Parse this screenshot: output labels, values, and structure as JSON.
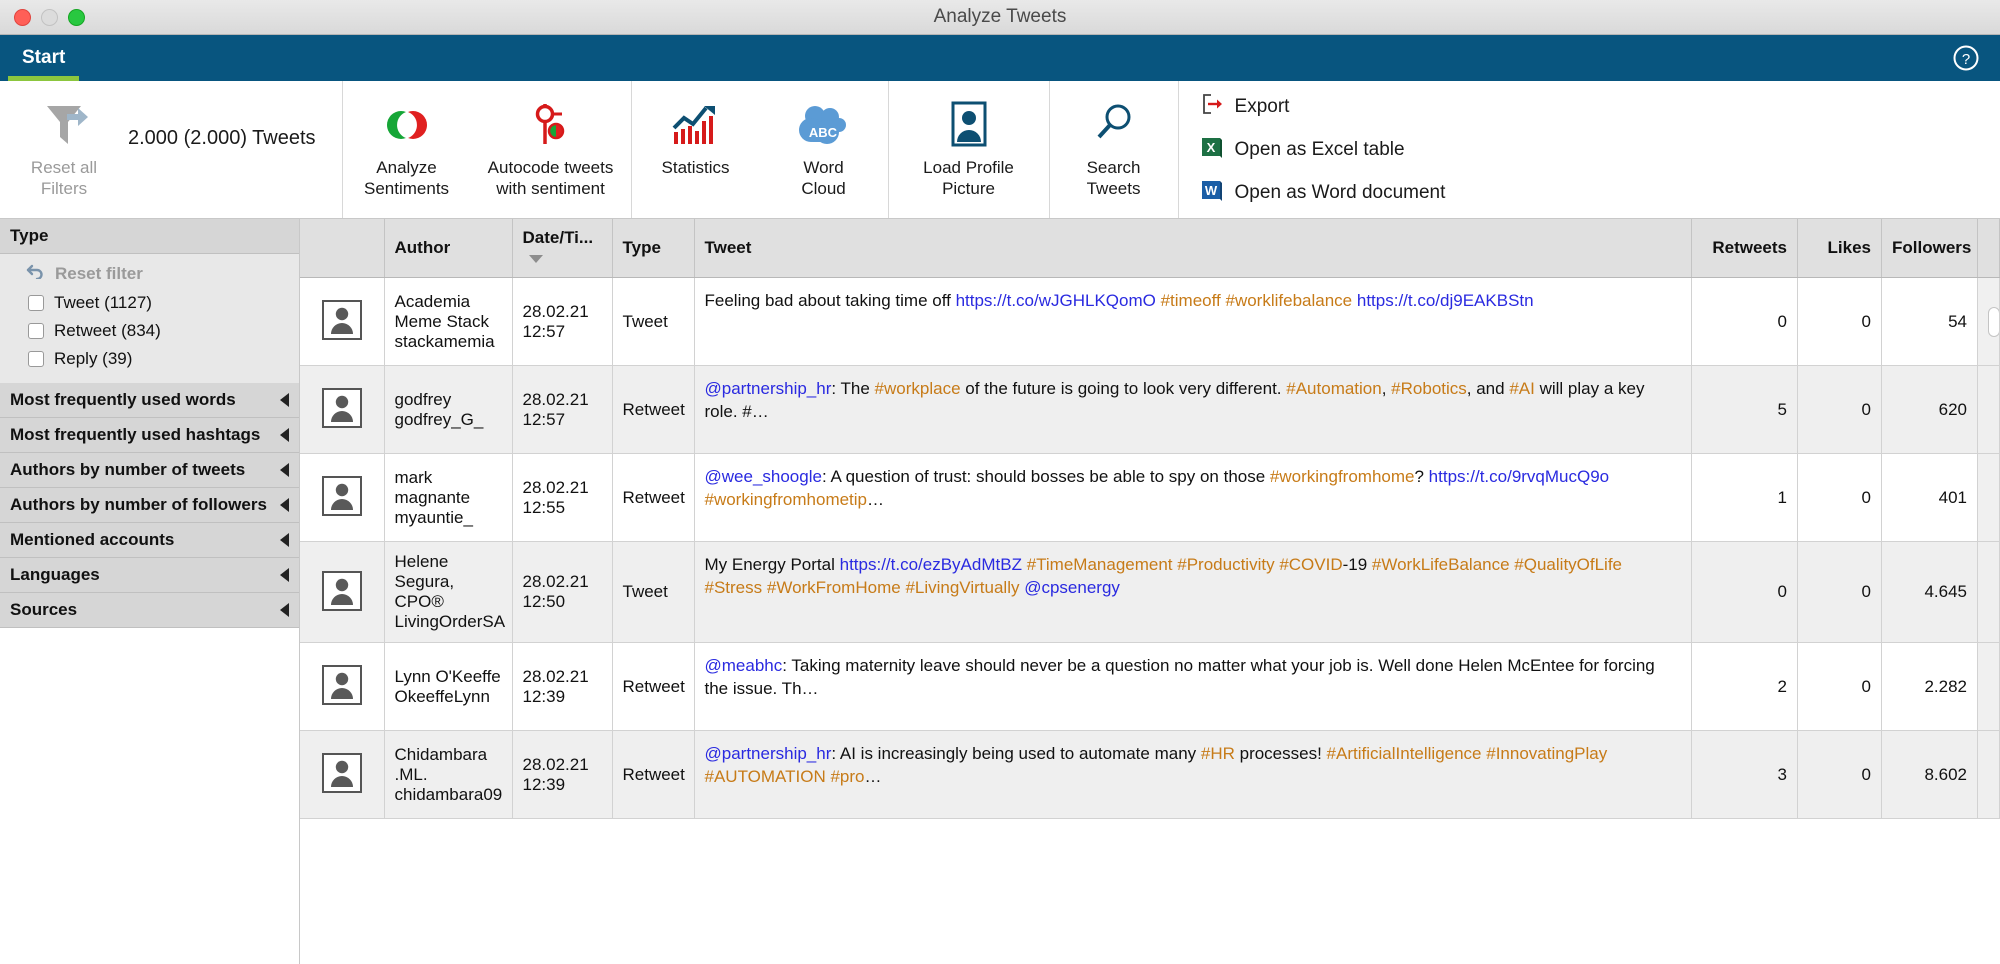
{
  "window": {
    "title": "Analyze Tweets"
  },
  "ribbon": {
    "tab_label": "Start",
    "help_icon": "help-circle-icon",
    "reset_all": {
      "icon": "reset-filter-funnel-icon",
      "label": "Reset all\nFilters"
    },
    "counter": "2.000 (2.000) Tweets",
    "items": [
      {
        "icon": "sentiment-circle-icon",
        "label": "Analyze\nSentiments"
      },
      {
        "icon": "autocode-sentiment-icon",
        "label": "Autocode tweets\nwith sentiment"
      },
      {
        "icon": "statistics-chart-icon",
        "label": "Statistics"
      },
      {
        "icon": "word-cloud-abc-icon",
        "label": "Word\nCloud"
      },
      {
        "icon": "profile-picture-icon",
        "label": "Load Profile\nPicture"
      },
      {
        "icon": "magnifier-search-icon",
        "label": "Search\nTweets"
      }
    ],
    "export": [
      {
        "icon": "export-arrow-icon",
        "label": "Export"
      },
      {
        "icon": "excel-icon",
        "label": "Open as Excel table"
      },
      {
        "icon": "word-icon",
        "label": "Open as Word document"
      }
    ]
  },
  "sidebar": {
    "sections": [
      {
        "title": "Type",
        "expanded": true,
        "reset_label": "Reset filter",
        "reset_icon": "undo-arrow-icon",
        "options": [
          {
            "label": "Tweet (1127)",
            "checked": false
          },
          {
            "label": "Retweet (834)",
            "checked": false
          },
          {
            "label": "Reply (39)",
            "checked": false
          }
        ]
      },
      {
        "title": "Most frequently used words",
        "expanded": false
      },
      {
        "title": "Most frequently used hashtags",
        "expanded": false
      },
      {
        "title": "Authors by number of tweets",
        "expanded": false
      },
      {
        "title": "Authors by number of followers",
        "expanded": false
      },
      {
        "title": "Mentioned accounts",
        "expanded": false
      },
      {
        "title": "Languages",
        "expanded": false
      },
      {
        "title": "Sources",
        "expanded": false
      }
    ]
  },
  "table": {
    "columns": [
      {
        "key": "avatar",
        "label": "",
        "align": "center"
      },
      {
        "key": "author",
        "label": "Author",
        "align": "left"
      },
      {
        "key": "date",
        "label": "Date/Ti...",
        "align": "left",
        "sorted": "desc"
      },
      {
        "key": "type",
        "label": "Type",
        "align": "left"
      },
      {
        "key": "tweet",
        "label": "Tweet",
        "align": "left"
      },
      {
        "key": "retweets",
        "label": "Retweets",
        "align": "right"
      },
      {
        "key": "likes",
        "label": "Likes",
        "align": "right"
      },
      {
        "key": "followers",
        "label": "Followers",
        "align": "right"
      }
    ],
    "rows": [
      {
        "avatar": "person-placeholder-icon",
        "author": "Academia Meme Stack\nstackamemia",
        "date": "28.02.21\n12:57",
        "type": "Tweet",
        "tweet_parts": [
          {
            "t": "Feeling bad about taking time off ",
            "c": "plain"
          },
          {
            "t": "https://t.co/wJGHLKQomO",
            "c": "link"
          },
          {
            "t": " ",
            "c": "plain"
          },
          {
            "t": "#timeoff",
            "c": "hash"
          },
          {
            "t": " ",
            "c": "plain"
          },
          {
            "t": "#worklifebalance",
            "c": "hash"
          },
          {
            "t": " ",
            "c": "plain"
          },
          {
            "t": "https://t.co/dj9EAKBStn",
            "c": "link"
          }
        ],
        "retweets": "0",
        "likes": "0",
        "followers": "54"
      },
      {
        "avatar": "person-placeholder-icon",
        "author": "godfrey\ngodfrey_G_",
        "date": "28.02.21\n12:57",
        "type": "Retweet",
        "tweet_parts": [
          {
            "t": "@partnership_hr",
            "c": "mention"
          },
          {
            "t": ": The ",
            "c": "plain"
          },
          {
            "t": "#workplace",
            "c": "hash"
          },
          {
            "t": " of the future is going to look very different. ",
            "c": "plain"
          },
          {
            "t": "#Automation",
            "c": "hash"
          },
          {
            "t": ", ",
            "c": "plain"
          },
          {
            "t": "#Robotics",
            "c": "hash"
          },
          {
            "t": ", and ",
            "c": "plain"
          },
          {
            "t": "#AI",
            "c": "hash"
          },
          {
            "t": " will play a key role. #…",
            "c": "plain"
          }
        ],
        "retweets": "5",
        "likes": "0",
        "followers": "620"
      },
      {
        "avatar": "person-placeholder-icon",
        "author": "mark magnante\nmyauntie_",
        "date": "28.02.21\n12:55",
        "type": "Retweet",
        "tweet_parts": [
          {
            "t": "@wee_shoogle",
            "c": "mention"
          },
          {
            "t": ": A question of trust: should bosses be able to spy on those ",
            "c": "plain"
          },
          {
            "t": "#workingfromhome",
            "c": "hash"
          },
          {
            "t": "? ",
            "c": "plain"
          },
          {
            "t": "https://t.co/9rvqMucQ9o",
            "c": "link"
          },
          {
            "t": " ",
            "c": "plain"
          },
          {
            "t": "#workingfromhometip",
            "c": "hash"
          },
          {
            "t": "…",
            "c": "plain"
          }
        ],
        "retweets": "1",
        "likes": "0",
        "followers": "401"
      },
      {
        "avatar": "person-placeholder-icon",
        "author": "Helene Segura, CPO®\nLivingOrderSA",
        "date": "28.02.21\n12:50",
        "type": "Tweet",
        "tweet_parts": [
          {
            "t": "My Energy Portal ",
            "c": "plain"
          },
          {
            "t": "https://t.co/ezByAdMtBZ",
            "c": "link"
          },
          {
            "t": " ",
            "c": "plain"
          },
          {
            "t": "#TimeManagement",
            "c": "hash"
          },
          {
            "t": " ",
            "c": "plain"
          },
          {
            "t": "#Productivity",
            "c": "hash"
          },
          {
            "t": " ",
            "c": "plain"
          },
          {
            "t": "#COVID",
            "c": "hash"
          },
          {
            "t": "-19 ",
            "c": "plain"
          },
          {
            "t": "#WorkLifeBalance",
            "c": "hash"
          },
          {
            "t": " ",
            "c": "plain"
          },
          {
            "t": "#QualityOfLife",
            "c": "hash"
          },
          {
            "t": " ",
            "c": "plain"
          },
          {
            "t": "#Stress",
            "c": "hash"
          },
          {
            "t": " ",
            "c": "plain"
          },
          {
            "t": "#WorkFromHome",
            "c": "hash"
          },
          {
            "t": " ",
            "c": "plain"
          },
          {
            "t": "#LivingVirtually",
            "c": "hash"
          },
          {
            "t": " ",
            "c": "plain"
          },
          {
            "t": "@cpsenergy",
            "c": "mention"
          }
        ],
        "retweets": "0",
        "likes": "0",
        "followers": "4.645"
      },
      {
        "avatar": "person-placeholder-icon",
        "author": "Lynn O'Keeffe\nOkeeffeLynn",
        "date": "28.02.21\n12:39",
        "type": "Retweet",
        "tweet_parts": [
          {
            "t": "@meabhc",
            "c": "mention"
          },
          {
            "t": ": Taking maternity leave should never be a question no matter what your job is. Well done Helen McEntee for forcing the issue. Th…",
            "c": "plain"
          }
        ],
        "retweets": "2",
        "likes": "0",
        "followers": "2.282"
      },
      {
        "avatar": "person-placeholder-icon",
        "author": "Chidambara .ML.\nchidambara09",
        "date": "28.02.21\n12:39",
        "type": "Retweet",
        "tweet_parts": [
          {
            "t": "@partnership_hr",
            "c": "mention"
          },
          {
            "t": ": AI is increasingly being used to automate many ",
            "c": "plain"
          },
          {
            "t": "#HR",
            "c": "hash"
          },
          {
            "t": " processes! ",
            "c": "plain"
          },
          {
            "t": "#ArtificialIntelligence",
            "c": "hash"
          },
          {
            "t": " ",
            "c": "plain"
          },
          {
            "t": "#InnovatingPlay",
            "c": "hash"
          },
          {
            "t": " ",
            "c": "plain"
          },
          {
            "t": "#AUTOMATION",
            "c": "hash"
          },
          {
            "t": " ",
            "c": "plain"
          },
          {
            "t": "#pro",
            "c": "hash"
          },
          {
            "t": "…",
            "c": "plain"
          }
        ],
        "retweets": "3",
        "likes": "0",
        "followers": "8.602"
      }
    ]
  },
  "colors": {
    "ribbon_blue": "#08557f",
    "tab_underline_green": "#8cc63e",
    "link_blue": "#2a2ae0",
    "hashtag_orange": "#c77b18"
  }
}
